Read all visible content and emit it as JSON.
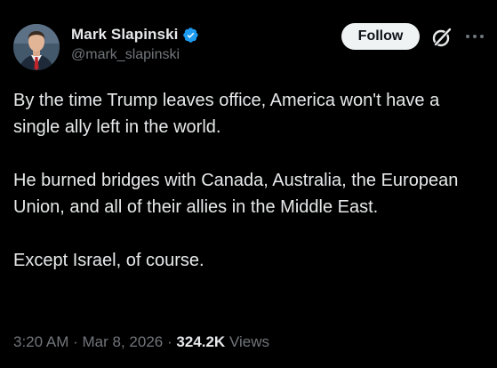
{
  "author": {
    "display_name": "Mark Slapinski",
    "handle": "@mark_slapinski",
    "verified": true,
    "avatar": "profile-photo"
  },
  "actions": {
    "follow_label": "Follow",
    "grok_icon": "grok-icon",
    "more_icon": "more-icon"
  },
  "tweet": {
    "paragraphs": [
      "By the time Trump leaves office, America won't have a single ally left in the world.",
      "He burned bridges with Canada, Australia, the European Union, and all of their allies in the Middle East.",
      "Except Israel, of course."
    ]
  },
  "meta": {
    "time": "3:20 AM",
    "separator": "·",
    "date": "Mar 8, 2026",
    "views_count": "324.2K",
    "views_label": "Views"
  },
  "colors": {
    "background": "#000000",
    "text": "#e7e9ea",
    "secondary_text": "#71767b",
    "verified_blue": "#1d9bf0",
    "follow_bg": "#eff3f4"
  }
}
